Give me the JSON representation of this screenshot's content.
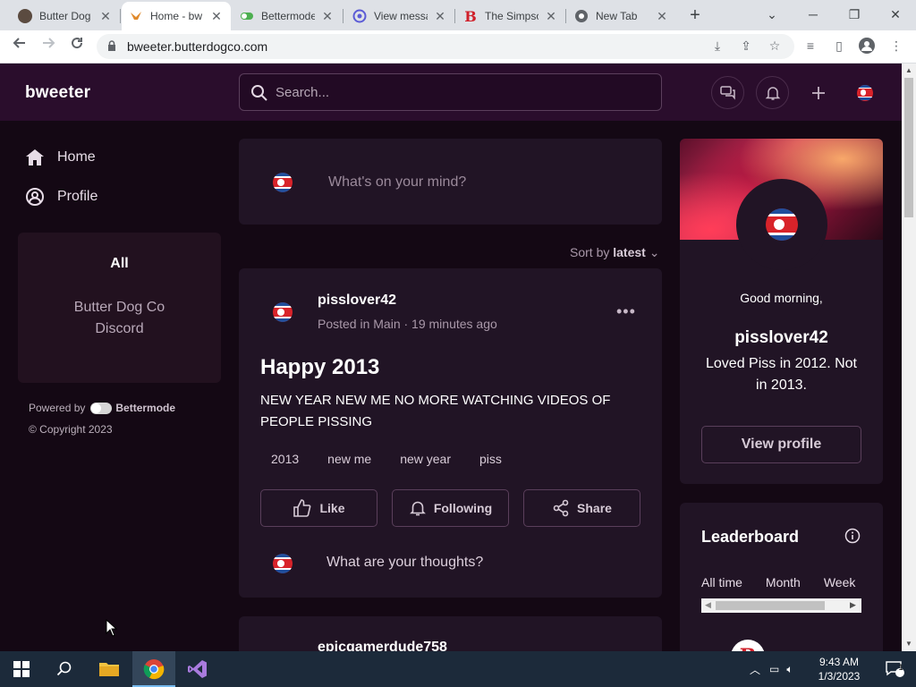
{
  "browser": {
    "tabs": [
      {
        "title": "Butter Dog",
        "active": false
      },
      {
        "title": "Home - bw",
        "active": true
      },
      {
        "title": "Bettermode",
        "active": false
      },
      {
        "title": "View messa",
        "active": false
      },
      {
        "title": "The Simpso",
        "active": false
      },
      {
        "title": "New Tab",
        "active": false
      }
    ],
    "url": "bweeter.butterdogco.com"
  },
  "app": {
    "logo": "bweeter",
    "search_placeholder": "Search...",
    "nav": [
      {
        "label": "Home",
        "icon": "home-icon"
      },
      {
        "label": "Profile",
        "icon": "user-circle-icon"
      }
    ],
    "spaces": {
      "all": "All",
      "items": [
        "Butter Dog Co Discord"
      ]
    },
    "powered_by": "Powered by",
    "powered_brand": "Bettermode",
    "copyright": "© Copyright 2023"
  },
  "composer": {
    "placeholder": "What's on your mind?"
  },
  "sort": {
    "label": "Sort by",
    "value": "latest"
  },
  "post": {
    "author": "pisslover42",
    "meta": "Posted in Main · 19 minutes ago",
    "title": "Happy 2013",
    "body": "NEW YEAR NEW ME NO MORE WATCHING VIDEOS OF PEOPLE PISSING",
    "tags": [
      "2013",
      "new me",
      "new year",
      "piss"
    ],
    "actions": {
      "like": "Like",
      "following": "Following",
      "share": "Share"
    },
    "reply_placeholder": "What are your thoughts?"
  },
  "next_post": {
    "author": "epicgamerdude758"
  },
  "profile": {
    "greeting": "Good morning,",
    "name": "pisslover42",
    "bio": "Loved Piss in 2012. Not in 2013.",
    "view_button": "View profile"
  },
  "leaderboard": {
    "title": "Leaderboard",
    "tabs": [
      "All time",
      "Month",
      "Week"
    ]
  },
  "taskbar": {
    "time": "9:43 AM",
    "date": "1/3/2023",
    "notification_count": "1"
  },
  "colors": {
    "app_bg": "#140814",
    "header_bg": "#2a0d2c",
    "card_bg": "#211425",
    "accent_red": "#d8232a"
  }
}
